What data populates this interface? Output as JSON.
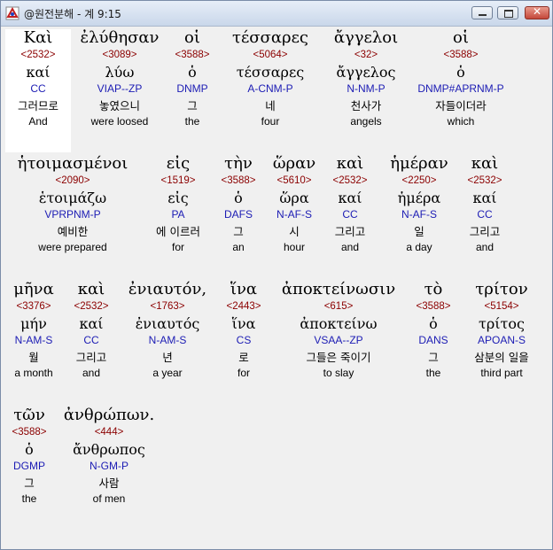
{
  "window": {
    "title": "@원전분해 - 계 9:15",
    "buttons": {
      "minimize": "minimize",
      "maximize": "maximize",
      "close": "✕"
    }
  },
  "words": [
    {
      "greek": "Καὶ",
      "strong": "<2532>",
      "lemma": "καί",
      "parse": "CC",
      "korean": "그러므로",
      "english": "And"
    },
    {
      "greek": "ἐλύθησαν",
      "strong": "<3089>",
      "lemma": "λύω",
      "parse": "VIAP--ZP",
      "korean": "놓였으니",
      "english": "were loosed"
    },
    {
      "greek": "οἱ",
      "strong": "<3588>",
      "lemma": "ὁ",
      "parse": "DNMP",
      "korean": "그",
      "english": "the"
    },
    {
      "greek": "τέσσαρες",
      "strong": "<5064>",
      "lemma": "τέσσαρες",
      "parse": "A-CNM-P",
      "korean": "네",
      "english": "four"
    },
    {
      "greek": "ἄγγελοι",
      "strong": "<32>",
      "lemma": "ἄγγελος",
      "parse": "N-NM-P",
      "korean": "천사가",
      "english": "angels"
    },
    {
      "greek": "οἱ",
      "strong": "<3588>",
      "lemma": "ὁ",
      "parse": "DNMP#APRNM-P",
      "korean": "자들이더라",
      "english": "which"
    },
    {
      "greek": "ἡτοιμασμένοι",
      "strong": "<2090>",
      "lemma": "ἑτοιμάζω",
      "parse": "VPRPNM-P",
      "korean": "예비한",
      "english": "were prepared"
    },
    {
      "greek": "εἰς",
      "strong": "<1519>",
      "lemma": "εἰς",
      "parse": "PA",
      "korean": "에 이르러",
      "english": "for"
    },
    {
      "greek": "τὴν",
      "strong": "<3588>",
      "lemma": "ὁ",
      "parse": "DAFS",
      "korean": "그",
      "english": "an"
    },
    {
      "greek": "ὥραν",
      "strong": "<5610>",
      "lemma": "ὥρα",
      "parse": "N-AF-S",
      "korean": "시",
      "english": "hour"
    },
    {
      "greek": "καὶ",
      "strong": "<2532>",
      "lemma": "καί",
      "parse": "CC",
      "korean": "그리고",
      "english": "and"
    },
    {
      "greek": "ἡμέραν",
      "strong": "<2250>",
      "lemma": "ἡμέρα",
      "parse": "N-AF-S",
      "korean": "일",
      "english": "a day"
    },
    {
      "greek": "καὶ",
      "strong": "<2532>",
      "lemma": "καί",
      "parse": "CC",
      "korean": "그리고",
      "english": "and"
    },
    {
      "greek": "μῆνα",
      "strong": "<3376>",
      "lemma": "μήν",
      "parse": "N-AM-S",
      "korean": "월",
      "english": "a month"
    },
    {
      "greek": "καὶ",
      "strong": "<2532>",
      "lemma": "καί",
      "parse": "CC",
      "korean": "그리고",
      "english": "and"
    },
    {
      "greek": "ἐνιαυτόν,",
      "strong": "<1763>",
      "lemma": "ἐνιαυτός",
      "parse": "N-AM-S",
      "korean": "년",
      "english": "a year"
    },
    {
      "greek": "ἵνα",
      "strong": "<2443>",
      "lemma": "ἵνα",
      "parse": "CS",
      "korean": "로",
      "english": "for"
    },
    {
      "greek": "ἀποκτείνωσιν",
      "strong": "<615>",
      "lemma": "ἀποκτείνω",
      "parse": "VSAA--ZP",
      "korean": "그들은 죽이기",
      "english": "to slay"
    },
    {
      "greek": "τὸ",
      "strong": "<3588>",
      "lemma": "ὁ",
      "parse": "DANS",
      "korean": "그",
      "english": "the"
    },
    {
      "greek": "τρίτον",
      "strong": "<5154>",
      "lemma": "τρίτος",
      "parse": "APOAN-S",
      "korean": "삼분의 일을",
      "english": "third part"
    },
    {
      "greek": "τῶν",
      "strong": "<3588>",
      "lemma": "ὁ",
      "parse": "DGMP",
      "korean": "그",
      "english": "the"
    },
    {
      "greek": "ἀνθρώπων.",
      "strong": "<444>",
      "lemma": "ἄνθρωπος",
      "parse": "N-GM-P",
      "korean": "사람",
      "english": "of men"
    }
  ]
}
